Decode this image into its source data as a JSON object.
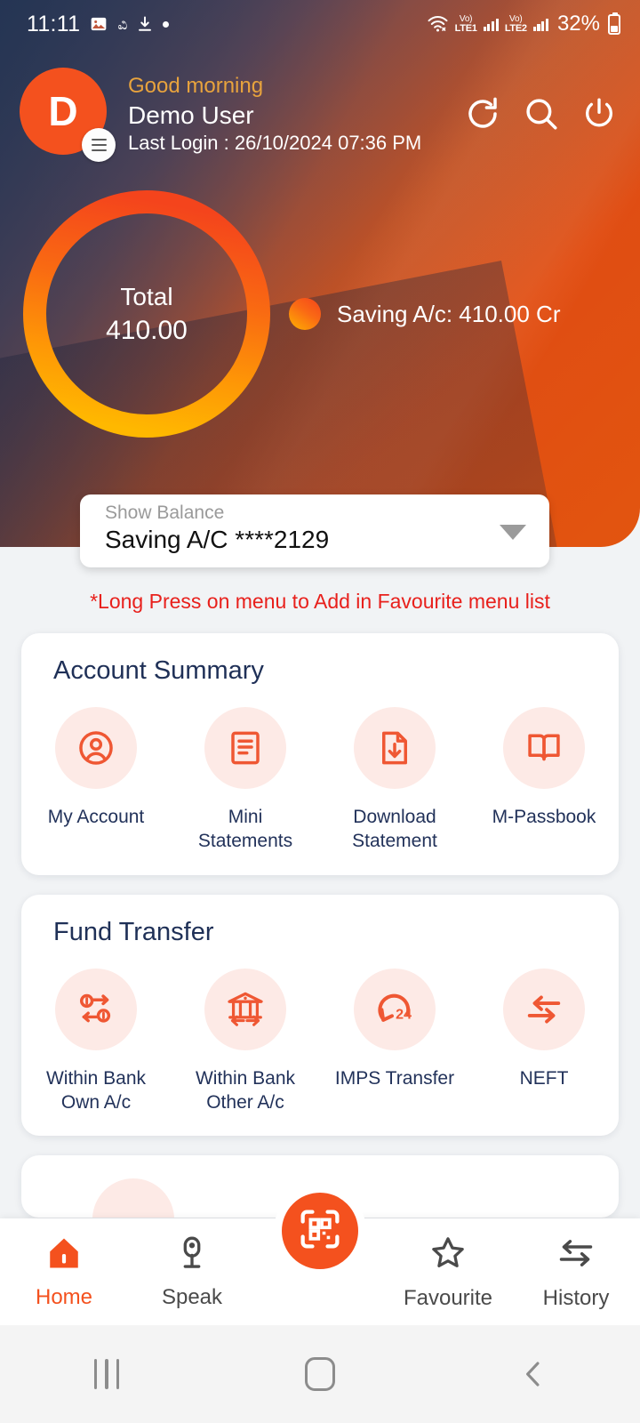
{
  "statusbar": {
    "time": "11:11",
    "icons_left": [
      "image-icon",
      "kannada-glyph",
      "download-icon",
      "dot-icon"
    ],
    "kannada_glyph": "ವಿ",
    "wifi": "wifi-icon",
    "sim1_top": "Vo)",
    "sim1_bottom": "LTE1",
    "sim2_top": "Vo)",
    "sim2_bottom": "LTE2",
    "battery_percent": "32%"
  },
  "header": {
    "avatar_initial": "D",
    "greeting": "Good morning",
    "username": "Demo User",
    "last_login": "Last Login  : 26/10/2024 07:36 PM",
    "actions": [
      "refresh-icon",
      "search-icon",
      "power-icon"
    ],
    "greeting_color": "#e8a33d",
    "accent_color": "#f4511e"
  },
  "balance_chart": {
    "center_label": "Total",
    "center_value": "410.00",
    "legend_label": "Saving A/c: 410.00 Cr",
    "ring_color_start": "#f4441c",
    "ring_color_end": "#ffb200"
  },
  "chart_data": {
    "type": "pie",
    "title": "Total",
    "categories": [
      "Saving A/c"
    ],
    "values": [
      410.0
    ],
    "labels": [
      "Saving A/c: 410.00 Cr"
    ],
    "total": "410.00",
    "legend_position": "right",
    "colors": [
      "#f4441c"
    ],
    "donut": true
  },
  "balance_selector": {
    "label": "Show Balance",
    "value": "Saving A/C ****2129",
    "dropdown_icon": "chevron-down-icon"
  },
  "note": "*Long Press on menu to Add in Favourite menu list",
  "cards": [
    {
      "title": "Account Summary",
      "tiles": [
        {
          "label": "My Account",
          "icon": "user-circle-icon"
        },
        {
          "label": "Mini Statements",
          "icon": "document-lines-icon"
        },
        {
          "label": "Download Statement",
          "icon": "file-download-icon"
        },
        {
          "label": "M-Passbook",
          "icon": "open-book-icon"
        }
      ]
    },
    {
      "title": "Fund Transfer",
      "tiles": [
        {
          "label": "Within Bank Own A/c",
          "icon": "coins-exchange-icon"
        },
        {
          "label": "Within Bank Other A/c",
          "icon": "bank-transfer-icon"
        },
        {
          "label": "IMPS Transfer",
          "icon": "clock-24-icon"
        },
        {
          "label": "NEFT",
          "icon": "two-way-arrows-icon"
        }
      ]
    }
  ],
  "bottom_nav": {
    "items": [
      {
        "label": "Home",
        "icon": "home-icon",
        "active": true
      },
      {
        "label": "Speak",
        "icon": "microphone-icon",
        "active": false
      },
      {
        "label": "Favourite",
        "icon": "star-icon",
        "active": false
      },
      {
        "label": "History",
        "icon": "history-arrows-icon",
        "active": false
      }
    ],
    "fab_icon": "qr-scan-icon"
  },
  "android_nav": {
    "recents": "recents-icon",
    "home": "home-square-icon",
    "back": "back-chevron-icon"
  }
}
